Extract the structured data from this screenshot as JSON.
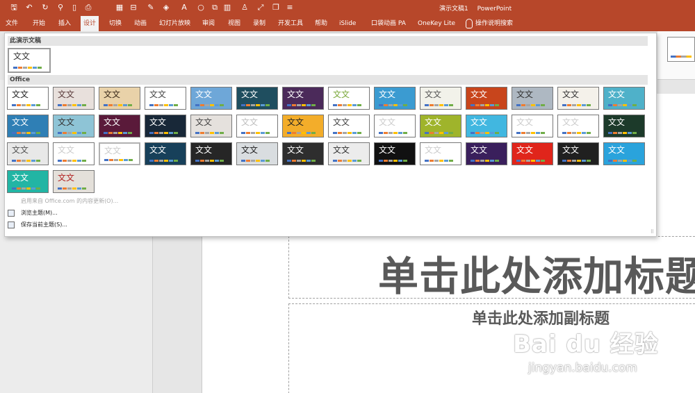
{
  "window": {
    "title": "演示文稿1",
    "app": "PowerPoint"
  },
  "quick_access": [
    {
      "icon": "save-icon",
      "glyph": "🖫"
    },
    {
      "icon": "undo-icon",
      "glyph": "↶"
    },
    {
      "icon": "redo-icon",
      "glyph": "↻"
    },
    {
      "icon": "format-painter-icon",
      "glyph": "⚲"
    },
    {
      "icon": "new-file-icon",
      "glyph": "▯"
    },
    {
      "icon": "print-preview-icon",
      "glyph": "⎙"
    },
    {
      "icon": "table-icon",
      "glyph": "▦"
    },
    {
      "icon": "align-icon",
      "glyph": "⊟"
    },
    {
      "icon": "eraser-icon",
      "glyph": "✎"
    },
    {
      "icon": "fill-color-icon",
      "glyph": "◈"
    },
    {
      "icon": "font-color-icon",
      "glyph": "A"
    },
    {
      "icon": "shape-icon",
      "glyph": "○"
    },
    {
      "icon": "arrange-icon",
      "glyph": "⧉"
    },
    {
      "icon": "chart-icon",
      "glyph": "▥"
    },
    {
      "icon": "person-icon",
      "glyph": "♙"
    },
    {
      "icon": "zoom-icon",
      "glyph": "⤢"
    },
    {
      "icon": "copy-icon",
      "glyph": "❐"
    },
    {
      "icon": "customize-icon",
      "glyph": "≡"
    }
  ],
  "tabs": [
    {
      "label": "文件",
      "active": false
    },
    {
      "label": "开始",
      "active": false
    },
    {
      "label": "插入",
      "active": false
    },
    {
      "label": "设计",
      "active": true
    },
    {
      "label": "切换",
      "active": false
    },
    {
      "label": "动画",
      "active": false
    },
    {
      "label": "幻灯片放映",
      "active": false
    },
    {
      "label": "审阅",
      "active": false
    },
    {
      "label": "视图",
      "active": false
    },
    {
      "label": "录制",
      "active": false
    },
    {
      "label": "开发工具",
      "active": false
    },
    {
      "label": "帮助",
      "active": false
    },
    {
      "label": "iSlide",
      "active": false
    },
    {
      "label": "口袋动画 PA",
      "active": false
    },
    {
      "label": "OneKey Lite",
      "active": false
    },
    {
      "label": "操作说明搜索",
      "active": false
    }
  ],
  "gallery": {
    "section_current": "此演示文稿",
    "section_office": "Office",
    "thumb_text": "文文",
    "current_theme": {
      "text": "文文",
      "bg": "#ffffff",
      "fg": "#333333"
    },
    "office_themes": [
      {
        "bg": "#ffffff",
        "fg": "#222222"
      },
      {
        "bg": "#e8e0dc",
        "fg": "#5a3a3a"
      },
      {
        "bg": "#e9d2a9",
        "fg": "#3a2a1a"
      },
      {
        "bg": "#ffffff",
        "fg": "#444444"
      },
      {
        "bg": "#6ea7d8",
        "fg": "#ffffff"
      },
      {
        "bg": "#1f4e5f",
        "fg": "#ffffff"
      },
      {
        "bg": "#4b2a5a",
        "fg": "#ffffff"
      },
      {
        "bg": "#ffffff",
        "fg": "#7aa83a"
      },
      {
        "bg": "#3b9bd1",
        "fg": "#ffffff"
      },
      {
        "bg": "#f2f2ea",
        "fg": "#555555"
      },
      {
        "bg": "#c8451c",
        "fg": "#ffffff"
      },
      {
        "bg": "#aeb8c2",
        "fg": "#333333"
      },
      {
        "bg": "#f4f1ea",
        "fg": "#333333"
      },
      {
        "bg": "#4fb1c9",
        "fg": "#ffffff"
      },
      {
        "bg": "#2f7fb5",
        "fg": "#ffffff"
      },
      {
        "bg": "#8ec4d6",
        "fg": "#333333"
      },
      {
        "bg": "#5a1a3a",
        "fg": "#ffffff"
      },
      {
        "bg": "#182838",
        "fg": "#ffffff"
      },
      {
        "bg": "#e5e1dd",
        "fg": "#444444"
      },
      {
        "bg": "#ffffff",
        "fg": "#bfbfbf"
      },
      {
        "bg": "#f3ad2a",
        "fg": "#222222"
      },
      {
        "bg": "#ffffff",
        "fg": "#444444"
      },
      {
        "bg": "#ffffff",
        "fg": "#cccccc"
      },
      {
        "bg": "#9fb42b",
        "fg": "#ffffff"
      },
      {
        "bg": "#41b7e0",
        "fg": "#ffffff"
      },
      {
        "bg": "#ffffff",
        "fg": "#cccccc"
      },
      {
        "bg": "#ffffff",
        "fg": "#cccccc"
      },
      {
        "bg": "#1c3a2a",
        "fg": "#ffffff"
      },
      {
        "bg": "#e8e8e8",
        "fg": "#555555"
      },
      {
        "bg": "#ffffff",
        "fg": "#cccccc"
      },
      {
        "bg": "#ffffff",
        "fg": "#cccccc"
      },
      {
        "bg": "#17405a",
        "fg": "#ffffff"
      },
      {
        "bg": "#262626",
        "fg": "#ffffff"
      },
      {
        "bg": "#d9dde0",
        "fg": "#222222"
      },
      {
        "bg": "#2e2e2e",
        "fg": "#ffffff"
      },
      {
        "bg": "#ececec",
        "fg": "#333333"
      },
      {
        "bg": "#111111",
        "fg": "#ffffff"
      },
      {
        "bg": "#ffffff",
        "fg": "#cccccc"
      },
      {
        "bg": "#3a1f5c",
        "fg": "#ffffff"
      },
      {
        "bg": "#e0251b",
        "fg": "#ffffff"
      },
      {
        "bg": "#202020",
        "fg": "#ffffff"
      },
      {
        "bg": "#2aa3dc",
        "fg": "#ffffff"
      },
      {
        "bg": "#22b5a4",
        "fg": "#ffffff"
      },
      {
        "bg": "#e4e0da",
        "fg": "#b22222"
      }
    ],
    "swatches": [
      "#4472c4",
      "#ed7d31",
      "#a5a5a5",
      "#ffc000",
      "#5b9bd5",
      "#70ad47"
    ],
    "menu": [
      {
        "icon": "office-update-icon",
        "label": "启用来自 Office.com 的内容更新(O)...",
        "enabled": false
      },
      {
        "icon": "browse-themes-icon",
        "label": "浏览主题(M)...",
        "enabled": true
      },
      {
        "icon": "save-theme-icon",
        "label": "保存当前主题(S)...",
        "enabled": true
      }
    ]
  },
  "slide": {
    "title_placeholder": "单击此处添加标题",
    "subtitle_placeholder": "单击此处添加副标题"
  },
  "watermark": {
    "line1": "Bai du 经验",
    "line2": "jingyan.baidu.com"
  }
}
